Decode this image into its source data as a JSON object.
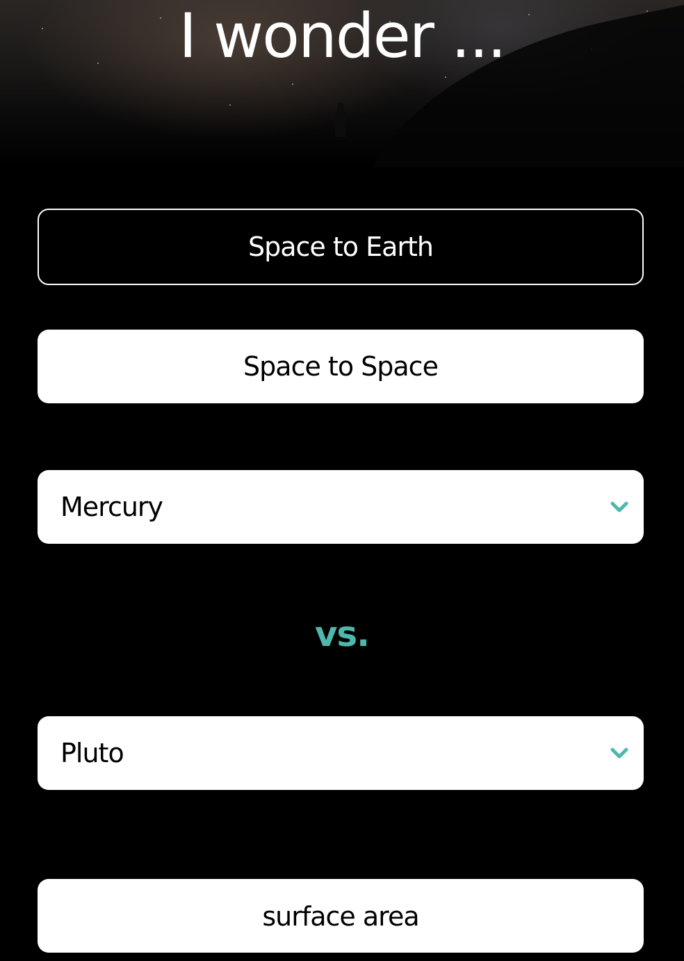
{
  "header": {
    "title": "I wonder ..."
  },
  "mode_buttons": {
    "space_to_earth": "Space to Earth",
    "space_to_space": "Space to Space"
  },
  "comparison": {
    "first_select": {
      "value": "Mercury",
      "icon": "chevron-down-icon"
    },
    "separator": "vs.",
    "second_select": {
      "value": "Pluto",
      "icon": "chevron-down-icon"
    }
  },
  "metric_button": {
    "label": "surface area"
  },
  "colors": {
    "accent": "#4fb8ad",
    "background": "#000000",
    "button": "#ffffff"
  }
}
